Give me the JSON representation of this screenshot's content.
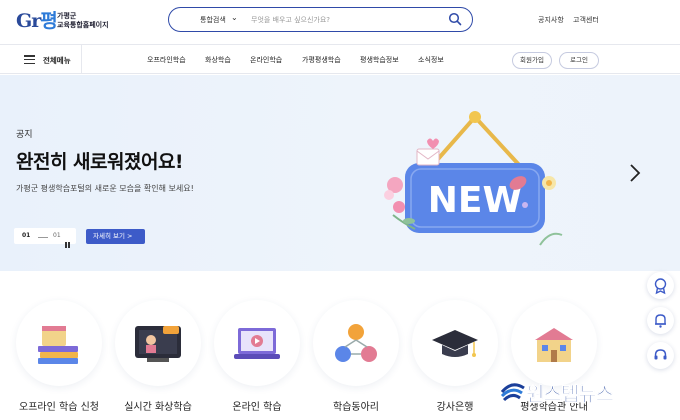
{
  "header": {
    "logo_mark": "G",
    "logo_mark_ko": "평",
    "logo_mark_a": "r",
    "logo_line1": "가평군",
    "logo_line2": "교육통합홈페이지",
    "search_category": "통합검색",
    "search_placeholder": "무엇을 배우고 싶으신가요?",
    "util_links": [
      "공지사항",
      "고객센터"
    ]
  },
  "gnb": {
    "all_menu_label": "전체메뉴",
    "items": [
      "오프라인학습",
      "화상학습",
      "온라인학습",
      "가평평생학습",
      "평생학습정보",
      "소식정보"
    ],
    "join_label": "회원가입",
    "login_label": "로그인"
  },
  "hero": {
    "eyebrow": "공지",
    "title": "완전히 새로워졌어요!",
    "description": "가평군 평생학습포털의 새로운 모습을 확인해 보세요!",
    "pager_current": "01",
    "pager_total": "01",
    "detail_button": "자세히 보기 >",
    "sign_text": "NEW"
  },
  "quick_menu": [
    {
      "label": "오프라인 학습 신청",
      "icon": "books-calendar-icon"
    },
    {
      "label": "실시간 화상학습",
      "icon": "live-video-icon"
    },
    {
      "label": "온라인 학습",
      "icon": "laptop-play-icon"
    },
    {
      "label": "학습동아리",
      "icon": "people-network-icon"
    },
    {
      "label": "강사은행",
      "icon": "graduation-cap-icon"
    },
    {
      "label": "평생학습관 안내",
      "icon": "building-icon"
    }
  ],
  "floating": [
    "badge-icon",
    "bell-icon",
    "headset-icon"
  ],
  "watermark": {
    "text": "원스텝뉴스"
  },
  "colors": {
    "primary": "#2f4aa8",
    "accent": "#3d5bc8",
    "hero_bg": "#eaf2fb"
  }
}
